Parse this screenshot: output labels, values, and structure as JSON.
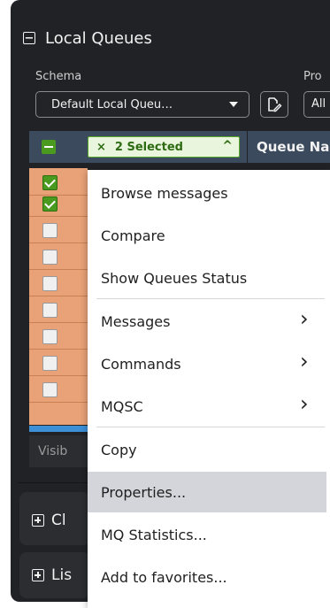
{
  "panel": {
    "title": "Local Queues",
    "schema_label": "Schema",
    "prop_label": "Pro",
    "schema_value": "Default Local Queu…",
    "all_value": "All"
  },
  "table": {
    "selection_text": "2 Selected",
    "selection_clear": "×",
    "selection_collapse": "^",
    "queue_name_header": "Queue Na",
    "rows_checked": [
      true,
      true,
      false,
      false,
      false,
      false,
      false,
      false,
      false
    ],
    "footer_text": "Visib"
  },
  "panels": [
    {
      "label": "Cl"
    },
    {
      "label": "Lis"
    }
  ],
  "context_menu": {
    "items": [
      {
        "label": "Browse messages"
      },
      {
        "label": "Compare"
      },
      {
        "label": "Show Queues Status"
      },
      {
        "label": "Messages",
        "submenu": true
      },
      {
        "label": "Commands",
        "submenu": true
      },
      {
        "label": "MQSC",
        "submenu": true
      },
      {
        "label": "Copy"
      },
      {
        "label": "Properties...",
        "highlighted": true
      },
      {
        "label": "MQ Statistics..."
      },
      {
        "label": "Add to favorites..."
      }
    ]
  },
  "colors": {
    "background": "#202225",
    "accent_green": "#4a9a1f",
    "row_orange": "#e9a277",
    "header_blue": "#3b4a5d"
  }
}
